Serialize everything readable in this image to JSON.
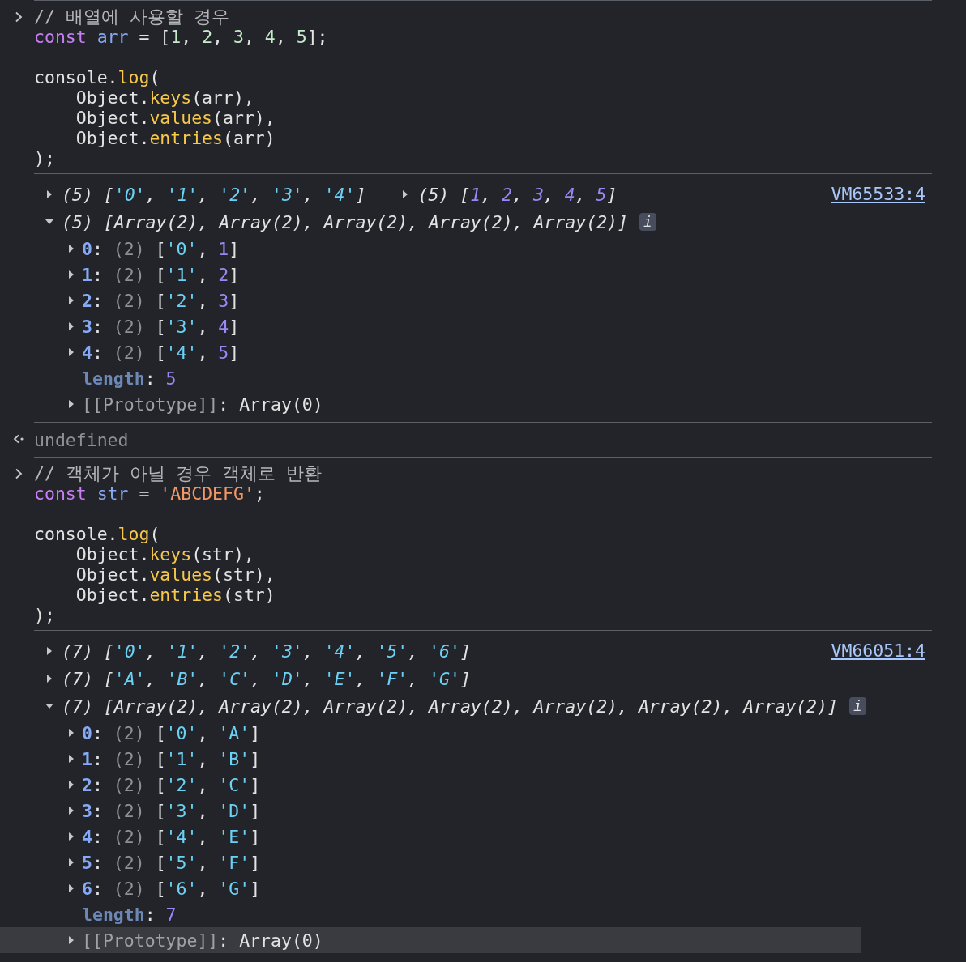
{
  "entries": [
    {
      "kind": "input",
      "blocks": [
        [
          [
            {
              "text": "// 배열에 사용할 경우",
              "kind": "comment"
            }
          ],
          [
            {
              "text": "const",
              "kind": "keyword"
            },
            {
              "text": " arr",
              "kind": "variable"
            },
            {
              "text": " = [",
              "kind": "plain"
            },
            {
              "text": "1",
              "kind": "literal"
            },
            {
              "text": ", ",
              "kind": "plain"
            },
            {
              "text": "2",
              "kind": "literal"
            },
            {
              "text": ", ",
              "kind": "plain"
            },
            {
              "text": "3",
              "kind": "literal"
            },
            {
              "text": ", ",
              "kind": "plain"
            },
            {
              "text": "4",
              "kind": "literal"
            },
            {
              "text": ", ",
              "kind": "plain"
            },
            {
              "text": "5",
              "kind": "literal"
            },
            {
              "text": "];",
              "kind": "plain"
            }
          ]
        ],
        [
          [
            {
              "text": "console.",
              "kind": "plain"
            },
            {
              "text": "log",
              "kind": "method"
            },
            {
              "text": "(",
              "kind": "plain"
            }
          ],
          [
            {
              "text": "    Object.",
              "kind": "plain"
            },
            {
              "text": "keys",
              "kind": "method"
            },
            {
              "text": "(arr),",
              "kind": "plain"
            }
          ],
          [
            {
              "text": "    Object.",
              "kind": "plain"
            },
            {
              "text": "values",
              "kind": "method"
            },
            {
              "text": "(arr),",
              "kind": "plain"
            }
          ],
          [
            {
              "text": "    Object.",
              "kind": "plain"
            },
            {
              "text": "entries",
              "kind": "method"
            },
            {
              "text": "(arr)",
              "kind": "plain"
            }
          ],
          [
            {
              "text": ");",
              "kind": "plain"
            }
          ]
        ]
      ]
    },
    {
      "kind": "output",
      "source": "VM65533:4",
      "rows": [
        {
          "previews": [
            {
              "expanded": false,
              "tokens": [
                {
                  "text": "(5) [",
                  "kind": "plain"
                },
                {
                  "text": "'0'",
                  "kind": "string"
                },
                {
                  "text": ", ",
                  "kind": "plain"
                },
                {
                  "text": "'1'",
                  "kind": "string"
                },
                {
                  "text": ", ",
                  "kind": "plain"
                },
                {
                  "text": "'2'",
                  "kind": "string"
                },
                {
                  "text": ", ",
                  "kind": "plain"
                },
                {
                  "text": "'3'",
                  "kind": "string"
                },
                {
                  "text": ", ",
                  "kind": "plain"
                },
                {
                  "text": "'4'",
                  "kind": "string"
                },
                {
                  "text": "]",
                  "kind": "plain"
                }
              ]
            },
            {
              "expanded": false,
              "tokens": [
                {
                  "text": "(5) [",
                  "kind": "plain"
                },
                {
                  "text": "1",
                  "kind": "number"
                },
                {
                  "text": ", ",
                  "kind": "plain"
                },
                {
                  "text": "2",
                  "kind": "number"
                },
                {
                  "text": ", ",
                  "kind": "plain"
                },
                {
                  "text": "3",
                  "kind": "number"
                },
                {
                  "text": ", ",
                  "kind": "plain"
                },
                {
                  "text": "4",
                  "kind": "number"
                },
                {
                  "text": ", ",
                  "kind": "plain"
                },
                {
                  "text": "5",
                  "kind": "number"
                },
                {
                  "text": "]",
                  "kind": "plain"
                }
              ]
            }
          ]
        },
        {
          "previews": [
            {
              "expanded": true,
              "info": "i",
              "tokens": [
                {
                  "text": "(5) [Array(2), Array(2), Array(2), Array(2), Array(2)]",
                  "kind": "plain"
                }
              ],
              "children": [
                {
                  "kind": "expandable",
                  "expanded": false,
                  "selected": false,
                  "tokens": [
                    {
                      "text": "0",
                      "kind": "key"
                    },
                    {
                      "text": ": ",
                      "kind": "plain"
                    },
                    {
                      "text": "(2)",
                      "kind": "dim"
                    },
                    {
                      "text": " [",
                      "kind": "plain"
                    },
                    {
                      "text": "'0'",
                      "kind": "string"
                    },
                    {
                      "text": ", ",
                      "kind": "plain"
                    },
                    {
                      "text": "1",
                      "kind": "number"
                    },
                    {
                      "text": "]",
                      "kind": "plain"
                    }
                  ]
                },
                {
                  "kind": "expandable",
                  "expanded": false,
                  "selected": false,
                  "tokens": [
                    {
                      "text": "1",
                      "kind": "key"
                    },
                    {
                      "text": ": ",
                      "kind": "plain"
                    },
                    {
                      "text": "(2)",
                      "kind": "dim"
                    },
                    {
                      "text": " [",
                      "kind": "plain"
                    },
                    {
                      "text": "'1'",
                      "kind": "string"
                    },
                    {
                      "text": ", ",
                      "kind": "plain"
                    },
                    {
                      "text": "2",
                      "kind": "number"
                    },
                    {
                      "text": "]",
                      "kind": "plain"
                    }
                  ]
                },
                {
                  "kind": "expandable",
                  "expanded": false,
                  "selected": false,
                  "tokens": [
                    {
                      "text": "2",
                      "kind": "key"
                    },
                    {
                      "text": ": ",
                      "kind": "plain"
                    },
                    {
                      "text": "(2)",
                      "kind": "dim"
                    },
                    {
                      "text": " [",
                      "kind": "plain"
                    },
                    {
                      "text": "'2'",
                      "kind": "string"
                    },
                    {
                      "text": ", ",
                      "kind": "plain"
                    },
                    {
                      "text": "3",
                      "kind": "number"
                    },
                    {
                      "text": "]",
                      "kind": "plain"
                    }
                  ]
                },
                {
                  "kind": "expandable",
                  "expanded": false,
                  "selected": false,
                  "tokens": [
                    {
                      "text": "3",
                      "kind": "key"
                    },
                    {
                      "text": ": ",
                      "kind": "plain"
                    },
                    {
                      "text": "(2)",
                      "kind": "dim"
                    },
                    {
                      "text": " [",
                      "kind": "plain"
                    },
                    {
                      "text": "'3'",
                      "kind": "string"
                    },
                    {
                      "text": ", ",
                      "kind": "plain"
                    },
                    {
                      "text": "4",
                      "kind": "number"
                    },
                    {
                      "text": "]",
                      "kind": "plain"
                    }
                  ]
                },
                {
                  "kind": "expandable",
                  "expanded": false,
                  "selected": false,
                  "tokens": [
                    {
                      "text": "4",
                      "kind": "key"
                    },
                    {
                      "text": ": ",
                      "kind": "plain"
                    },
                    {
                      "text": "(2)",
                      "kind": "dim"
                    },
                    {
                      "text": " [",
                      "kind": "plain"
                    },
                    {
                      "text": "'4'",
                      "kind": "string"
                    },
                    {
                      "text": ", ",
                      "kind": "plain"
                    },
                    {
                      "text": "5",
                      "kind": "number"
                    },
                    {
                      "text": "]",
                      "kind": "plain"
                    }
                  ]
                },
                {
                  "kind": "plain",
                  "selected": false,
                  "tokens": [
                    {
                      "text": "length",
                      "kind": "dimkey"
                    },
                    {
                      "text": ": ",
                      "kind": "plain"
                    },
                    {
                      "text": "5",
                      "kind": "number"
                    }
                  ]
                },
                {
                  "kind": "expandable",
                  "expanded": false,
                  "selected": false,
                  "tokens": [
                    {
                      "text": "[[Prototype]]",
                      "kind": "proto"
                    },
                    {
                      "text": ": Array(0)",
                      "kind": "plain"
                    }
                  ]
                }
              ]
            }
          ]
        }
      ]
    },
    {
      "kind": "result",
      "text": "undefined"
    },
    {
      "kind": "input",
      "blocks": [
        [
          [
            {
              "text": "// 객체가 아닐 경우 객체로 반환",
              "kind": "comment"
            }
          ],
          [
            {
              "text": "const",
              "kind": "keyword"
            },
            {
              "text": " str",
              "kind": "variable"
            },
            {
              "text": " = ",
              "kind": "plain"
            },
            {
              "text": "'ABCDEFG'",
              "kind": "strlit"
            },
            {
              "text": ";",
              "kind": "plain"
            }
          ]
        ],
        [
          [
            {
              "text": "console.",
              "kind": "plain"
            },
            {
              "text": "log",
              "kind": "method"
            },
            {
              "text": "(",
              "kind": "plain"
            }
          ],
          [
            {
              "text": "    Object.",
              "kind": "plain"
            },
            {
              "text": "keys",
              "kind": "method"
            },
            {
              "text": "(str),",
              "kind": "plain"
            }
          ],
          [
            {
              "text": "    Object.",
              "kind": "plain"
            },
            {
              "text": "values",
              "kind": "method"
            },
            {
              "text": "(str),",
              "kind": "plain"
            }
          ],
          [
            {
              "text": "    Object.",
              "kind": "plain"
            },
            {
              "text": "entries",
              "kind": "method"
            },
            {
              "text": "(str)",
              "kind": "plain"
            }
          ],
          [
            {
              "text": ");",
              "kind": "plain"
            }
          ]
        ]
      ]
    },
    {
      "kind": "output",
      "source": "VM66051:4",
      "rows": [
        {
          "previews": [
            {
              "expanded": false,
              "tokens": [
                {
                  "text": "(7) [",
                  "kind": "plain"
                },
                {
                  "text": "'0'",
                  "kind": "string"
                },
                {
                  "text": ", ",
                  "kind": "plain"
                },
                {
                  "text": "'1'",
                  "kind": "string"
                },
                {
                  "text": ", ",
                  "kind": "plain"
                },
                {
                  "text": "'2'",
                  "kind": "string"
                },
                {
                  "text": ", ",
                  "kind": "plain"
                },
                {
                  "text": "'3'",
                  "kind": "string"
                },
                {
                  "text": ", ",
                  "kind": "plain"
                },
                {
                  "text": "'4'",
                  "kind": "string"
                },
                {
                  "text": ", ",
                  "kind": "plain"
                },
                {
                  "text": "'5'",
                  "kind": "string"
                },
                {
                  "text": ", ",
                  "kind": "plain"
                },
                {
                  "text": "'6'",
                  "kind": "string"
                },
                {
                  "text": "]",
                  "kind": "plain"
                }
              ]
            }
          ]
        },
        {
          "previews": [
            {
              "expanded": false,
              "tokens": [
                {
                  "text": "(7) [",
                  "kind": "plain"
                },
                {
                  "text": "'A'",
                  "kind": "string"
                },
                {
                  "text": ", ",
                  "kind": "plain"
                },
                {
                  "text": "'B'",
                  "kind": "string"
                },
                {
                  "text": ", ",
                  "kind": "plain"
                },
                {
                  "text": "'C'",
                  "kind": "string"
                },
                {
                  "text": ", ",
                  "kind": "plain"
                },
                {
                  "text": "'D'",
                  "kind": "string"
                },
                {
                  "text": ", ",
                  "kind": "plain"
                },
                {
                  "text": "'E'",
                  "kind": "string"
                },
                {
                  "text": ", ",
                  "kind": "plain"
                },
                {
                  "text": "'F'",
                  "kind": "string"
                },
                {
                  "text": ", ",
                  "kind": "plain"
                },
                {
                  "text": "'G'",
                  "kind": "string"
                },
                {
                  "text": "]",
                  "kind": "plain"
                }
              ]
            }
          ]
        },
        {
          "previews": [
            {
              "expanded": true,
              "info": "i",
              "tokens": [
                {
                  "text": "(7) [Array(2), Array(2), Array(2), Array(2), Array(2), Array(2), Array(2)]",
                  "kind": "plain"
                }
              ],
              "children": [
                {
                  "kind": "expandable",
                  "expanded": false,
                  "selected": false,
                  "tokens": [
                    {
                      "text": "0",
                      "kind": "key"
                    },
                    {
                      "text": ": ",
                      "kind": "plain"
                    },
                    {
                      "text": "(2)",
                      "kind": "dim"
                    },
                    {
                      "text": " [",
                      "kind": "plain"
                    },
                    {
                      "text": "'0'",
                      "kind": "string"
                    },
                    {
                      "text": ", ",
                      "kind": "plain"
                    },
                    {
                      "text": "'A'",
                      "kind": "string"
                    },
                    {
                      "text": "]",
                      "kind": "plain"
                    }
                  ]
                },
                {
                  "kind": "expandable",
                  "expanded": false,
                  "selected": false,
                  "tokens": [
                    {
                      "text": "1",
                      "kind": "key"
                    },
                    {
                      "text": ": ",
                      "kind": "plain"
                    },
                    {
                      "text": "(2)",
                      "kind": "dim"
                    },
                    {
                      "text": " [",
                      "kind": "plain"
                    },
                    {
                      "text": "'1'",
                      "kind": "string"
                    },
                    {
                      "text": ", ",
                      "kind": "plain"
                    },
                    {
                      "text": "'B'",
                      "kind": "string"
                    },
                    {
                      "text": "]",
                      "kind": "plain"
                    }
                  ]
                },
                {
                  "kind": "expandable",
                  "expanded": false,
                  "selected": false,
                  "tokens": [
                    {
                      "text": "2",
                      "kind": "key"
                    },
                    {
                      "text": ": ",
                      "kind": "plain"
                    },
                    {
                      "text": "(2)",
                      "kind": "dim"
                    },
                    {
                      "text": " [",
                      "kind": "plain"
                    },
                    {
                      "text": "'2'",
                      "kind": "string"
                    },
                    {
                      "text": ", ",
                      "kind": "plain"
                    },
                    {
                      "text": "'C'",
                      "kind": "string"
                    },
                    {
                      "text": "]",
                      "kind": "plain"
                    }
                  ]
                },
                {
                  "kind": "expandable",
                  "expanded": false,
                  "selected": false,
                  "tokens": [
                    {
                      "text": "3",
                      "kind": "key"
                    },
                    {
                      "text": ": ",
                      "kind": "plain"
                    },
                    {
                      "text": "(2)",
                      "kind": "dim"
                    },
                    {
                      "text": " [",
                      "kind": "plain"
                    },
                    {
                      "text": "'3'",
                      "kind": "string"
                    },
                    {
                      "text": ", ",
                      "kind": "plain"
                    },
                    {
                      "text": "'D'",
                      "kind": "string"
                    },
                    {
                      "text": "]",
                      "kind": "plain"
                    }
                  ]
                },
                {
                  "kind": "expandable",
                  "expanded": false,
                  "selected": false,
                  "tokens": [
                    {
                      "text": "4",
                      "kind": "key"
                    },
                    {
                      "text": ": ",
                      "kind": "plain"
                    },
                    {
                      "text": "(2)",
                      "kind": "dim"
                    },
                    {
                      "text": " [",
                      "kind": "plain"
                    },
                    {
                      "text": "'4'",
                      "kind": "string"
                    },
                    {
                      "text": ", ",
                      "kind": "plain"
                    },
                    {
                      "text": "'E'",
                      "kind": "string"
                    },
                    {
                      "text": "]",
                      "kind": "plain"
                    }
                  ]
                },
                {
                  "kind": "expandable",
                  "expanded": false,
                  "selected": false,
                  "tokens": [
                    {
                      "text": "5",
                      "kind": "key"
                    },
                    {
                      "text": ": ",
                      "kind": "plain"
                    },
                    {
                      "text": "(2)",
                      "kind": "dim"
                    },
                    {
                      "text": " [",
                      "kind": "plain"
                    },
                    {
                      "text": "'5'",
                      "kind": "string"
                    },
                    {
                      "text": ", ",
                      "kind": "plain"
                    },
                    {
                      "text": "'F'",
                      "kind": "string"
                    },
                    {
                      "text": "]",
                      "kind": "plain"
                    }
                  ]
                },
                {
                  "kind": "expandable",
                  "expanded": false,
                  "selected": false,
                  "tokens": [
                    {
                      "text": "6",
                      "kind": "key"
                    },
                    {
                      "text": ": ",
                      "kind": "plain"
                    },
                    {
                      "text": "(2)",
                      "kind": "dim"
                    },
                    {
                      "text": " [",
                      "kind": "plain"
                    },
                    {
                      "text": "'6'",
                      "kind": "string"
                    },
                    {
                      "text": ", ",
                      "kind": "plain"
                    },
                    {
                      "text": "'G'",
                      "kind": "string"
                    },
                    {
                      "text": "]",
                      "kind": "plain"
                    }
                  ]
                },
                {
                  "kind": "plain",
                  "selected": false,
                  "tokens": [
                    {
                      "text": "length",
                      "kind": "dimkey"
                    },
                    {
                      "text": ": ",
                      "kind": "plain"
                    },
                    {
                      "text": "7",
                      "kind": "number"
                    }
                  ]
                },
                {
                  "kind": "expandable",
                  "expanded": false,
                  "selected": true,
                  "tokens": [
                    {
                      "text": "[[Prototype]]",
                      "kind": "proto"
                    },
                    {
                      "text": ": Array(0)",
                      "kind": "plain"
                    }
                  ]
                }
              ]
            }
          ]
        }
      ]
    }
  ]
}
